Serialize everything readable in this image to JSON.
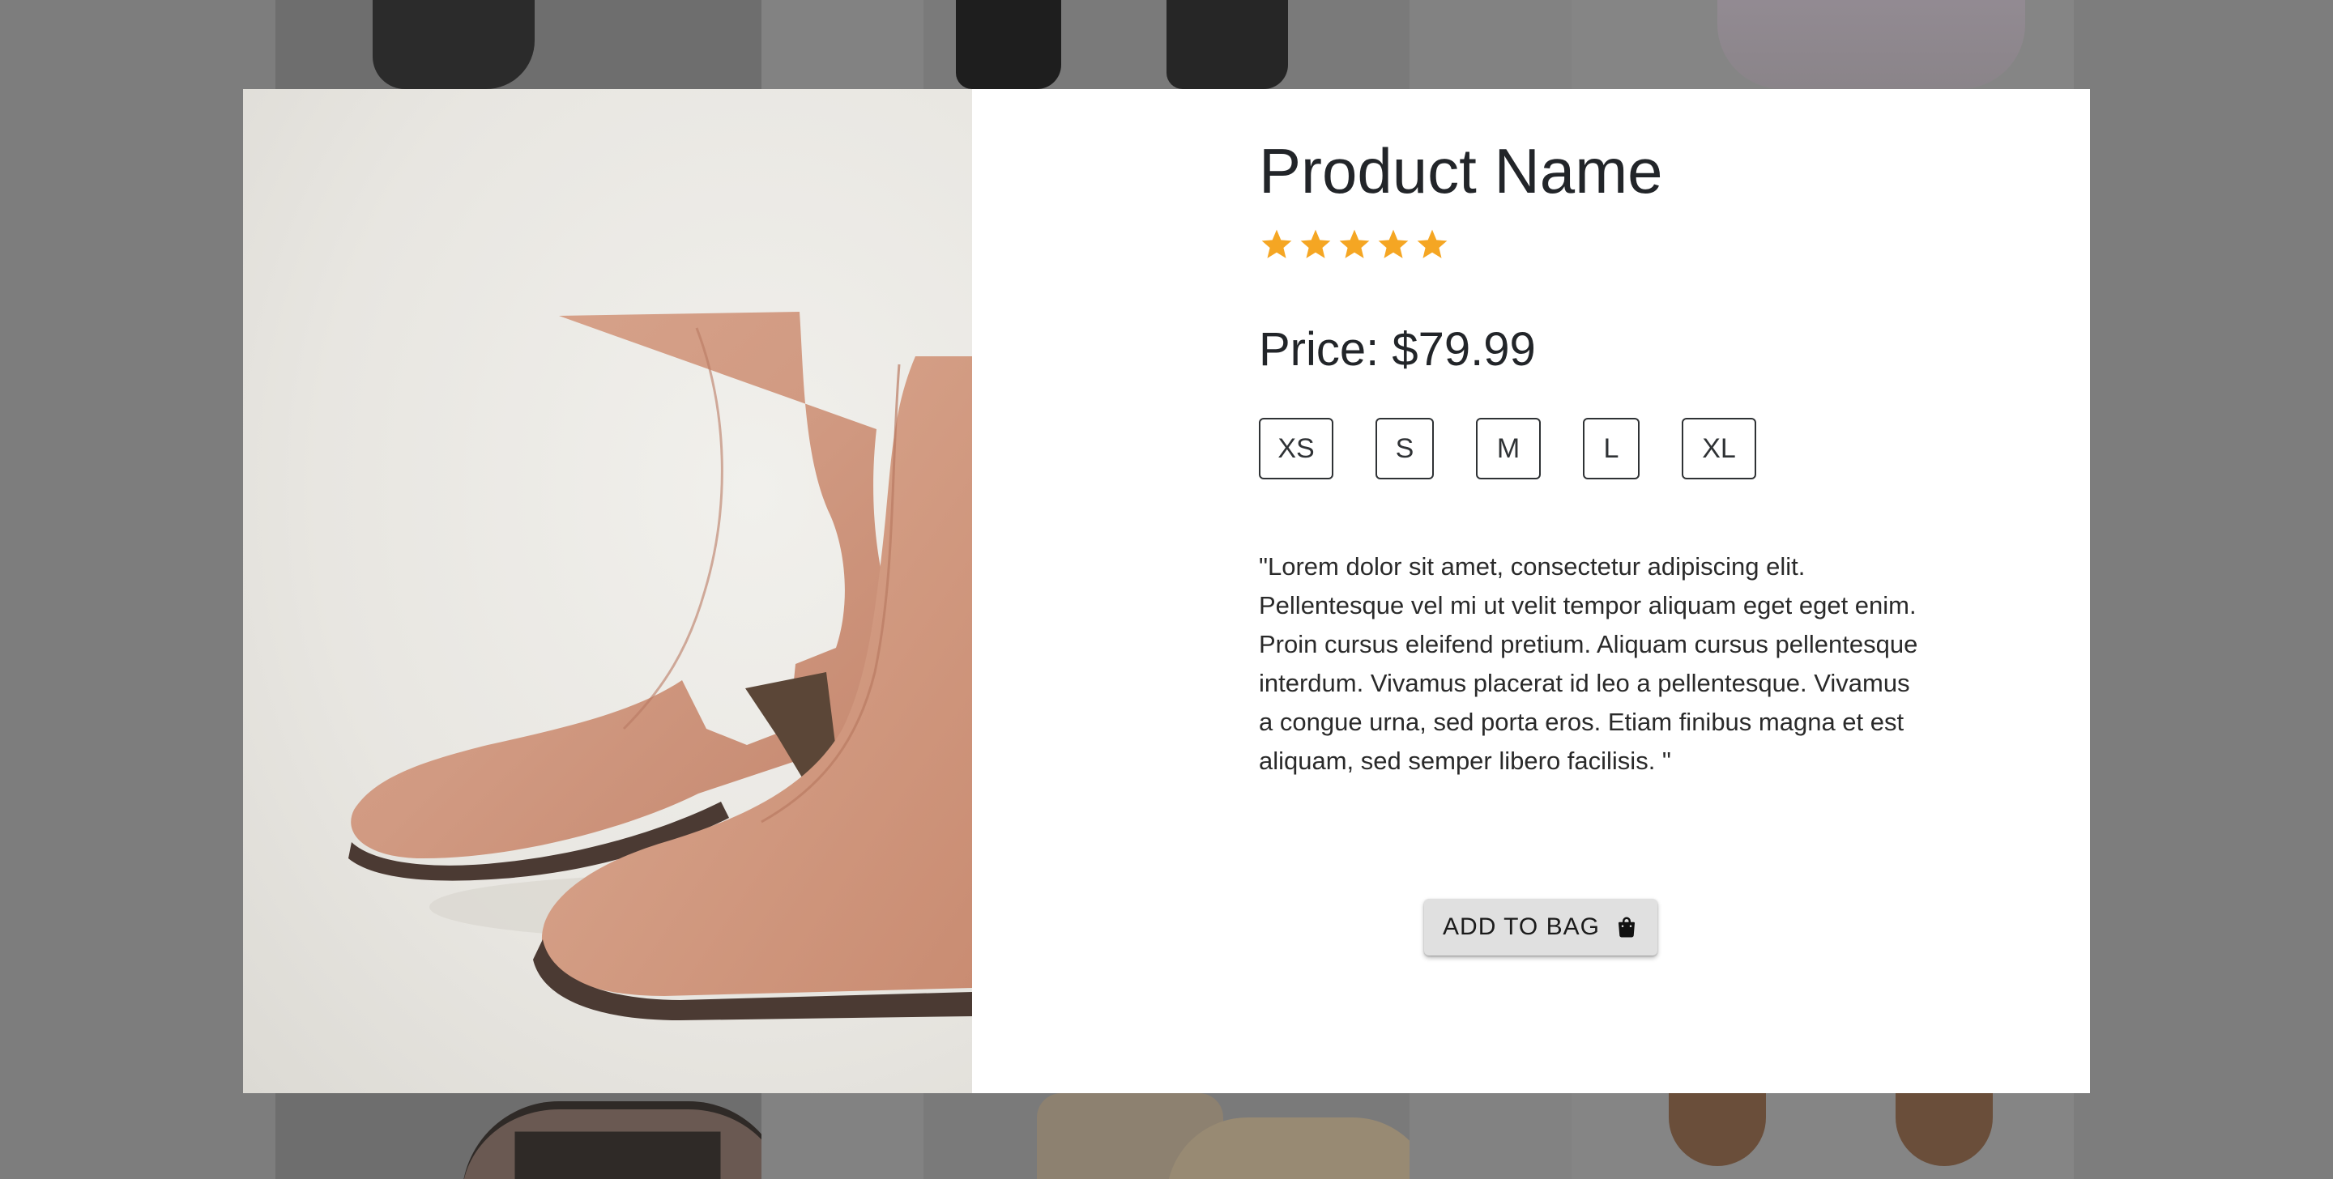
{
  "product": {
    "title": "Product Name",
    "rating": 5,
    "rating_max": 5,
    "price_label": "Price: $79.99",
    "sizes": [
      "XS",
      "S",
      "M",
      "L",
      "XL"
    ],
    "description": "\"Lorem dolor sit amet, consectetur adipiscing elit. Pellentesque vel mi ut velit tempor aliquam eget eget enim. Proin cursus eleifend pretium. Aliquam cursus pellentesque interdum. Vivamus placerat id leo a pellentesque. Vivamus a congue urna, sed porta eros. Etiam finibus magna et est aliquam, sed semper libero facilisis. \"",
    "add_to_bag_label": "ADD TO BAG",
    "add_to_bag_icon": "shopping-bag-icon",
    "image": "tan-leather-ankle-boots"
  },
  "colors": {
    "star": "#f5a623",
    "overlay": "#7d7d7d",
    "button_bg": "#e0e0e0",
    "text": "#222529"
  }
}
